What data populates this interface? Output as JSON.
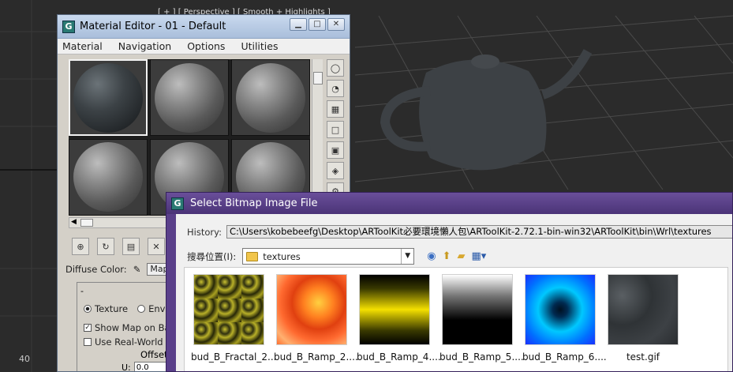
{
  "viewport": {
    "label": "[ + ] [ Perspective ] [ Smooth + Highlights ]",
    "ruler_value": "40"
  },
  "material_editor": {
    "title": "Material Editor - 01 - Default",
    "menu": [
      "Material",
      "Navigation",
      "Options",
      "Utilities"
    ],
    "slots": [
      {
        "type": "texture",
        "active": true
      },
      {
        "type": "plain",
        "active": false
      },
      {
        "type": "plain",
        "active": false
      },
      {
        "type": "plain",
        "active": false
      },
      {
        "type": "plain",
        "active": false
      },
      {
        "type": "plain",
        "active": false
      }
    ],
    "diffuse_label": "Diffuse Color:",
    "map_button": "Map",
    "rollout_minus": "-",
    "texture_option": "Texture",
    "environ_option": "Enviro",
    "show_map": "Show Map on Back",
    "real_world": "Use Real-World Sc",
    "offset_label": "Offset",
    "u_label": "U:",
    "u_value": "0.0"
  },
  "bitmap_dialog": {
    "title": "Select Bitmap Image File",
    "history_label": "History:",
    "history_path": "C:\\Users\\kobebeefg\\Desktop\\ARToolKit必要環境懶人包\\ARToolKit-2.72.1-bin-win32\\ARToolKit\\bin\\Wrl\\textures",
    "look_in_label": "搜尋位置(I):",
    "folder": "textures",
    "files": [
      {
        "name": "bud_B_Fractal_2...",
        "swatch": "fractal"
      },
      {
        "name": "bud_B_Ramp_2....",
        "swatch": "ramp2"
      },
      {
        "name": "bud_B_Ramp_4....",
        "swatch": "ramp4"
      },
      {
        "name": "bud_B_Ramp_5....",
        "swatch": "ramp5"
      },
      {
        "name": "bud_B_Ramp_6....",
        "swatch": "ramp6"
      },
      {
        "name": "test.gif",
        "swatch": "test"
      }
    ]
  },
  "colors": {
    "viewport_bg": "#2b2b2b",
    "dialog_title": "#4a3377",
    "editor_title": "#a9bedb"
  }
}
